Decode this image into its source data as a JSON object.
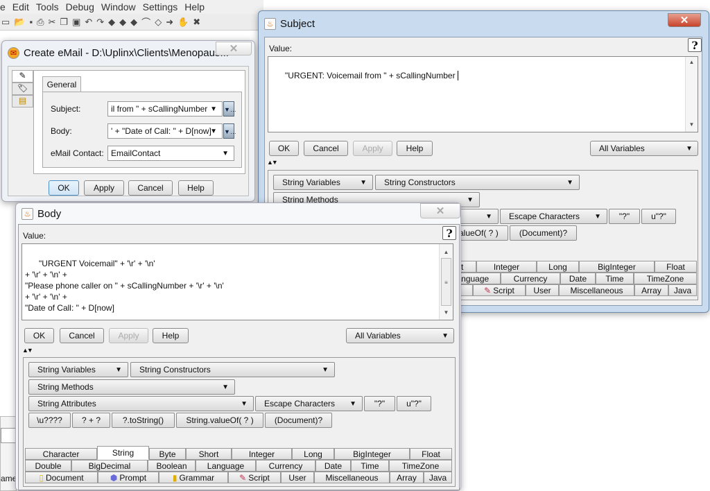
{
  "menubar": {
    "items": [
      "e",
      "Edit",
      "Tools",
      "Debug",
      "Window",
      "Settings",
      "Help"
    ]
  },
  "toolbar": {
    "icons": [
      "new-icon",
      "open-icon",
      "save-icon",
      "print-icon",
      "cut-icon",
      "copy-icon",
      "paste-icon",
      "undo-icon",
      "redo-icon",
      "step-icon",
      "step-over-icon",
      "step-out-icon",
      "run-icon",
      "run-to-icon",
      "deploy-icon",
      "stop-hand-icon",
      "cancel-icon"
    ]
  },
  "background": {
    "fragment": "ame"
  },
  "create_email": {
    "title": "Create eMail - D:\\Uplinx\\Clients\\Menopaus...",
    "tab": "General",
    "fields": [
      {
        "label": "Subject:",
        "value": "il from \" + sCallingNumber"
      },
      {
        "label": "Body:",
        "value": "' + \"Date of Call: \" + D[now]"
      },
      {
        "label": "eMail Contact:",
        "value": "EmailContact"
      }
    ],
    "buttons": {
      "ok": "OK",
      "apply": "Apply",
      "cancel": "Cancel",
      "help": "Help"
    }
  },
  "subject": {
    "title": "Subject",
    "value_label": "Value:",
    "value": "\"URGENT: Voicemail from \" + sCallingNumber",
    "buttons": {
      "ok": "OK",
      "cancel": "Cancel",
      "apply": "Apply",
      "help": "Help"
    },
    "variables_select": "All Variables",
    "help_glyph": "?"
  },
  "body": {
    "title": "Body",
    "value_label": "Value:",
    "value": "\"URGENT Voicemail\" + '\\r' + '\\n'\n+ '\\r' + '\\n' +\n\"Please phone caller on \" + sCallingNumber + '\\r' + '\\n'\n+ '\\r' + '\\n' +\n\"Date of Call: \" + D[now]",
    "buttons": {
      "ok": "OK",
      "cancel": "Cancel",
      "apply": "Apply",
      "help": "Help"
    },
    "variables_select": "All Variables",
    "help_glyph": "?"
  },
  "palette": {
    "toggle": "▲▼",
    "dropdowns": [
      "String Variables",
      "String Constructors",
      "String Methods",
      "String Attributes",
      "Escape Characters"
    ],
    "buttons": [
      "\"?\"",
      "u\"?\"",
      "\\u????",
      "? + ?",
      "?.toString()",
      "String.valueOf( ? )",
      "(Document)?"
    ],
    "tab_rows": [
      [
        "Character",
        "String",
        "Byte",
        "Short",
        "Integer",
        "Long",
        "BigInteger",
        "Float"
      ],
      [
        "Double",
        "BigDecimal",
        "Boolean",
        "Language",
        "Currency",
        "Date",
        "Time",
        "TimeZone"
      ],
      [
        "Document",
        "Prompt",
        "Grammar",
        "Script",
        "User",
        "Miscellaneous",
        "Array",
        "Java"
      ]
    ],
    "selected_tab": "String"
  }
}
